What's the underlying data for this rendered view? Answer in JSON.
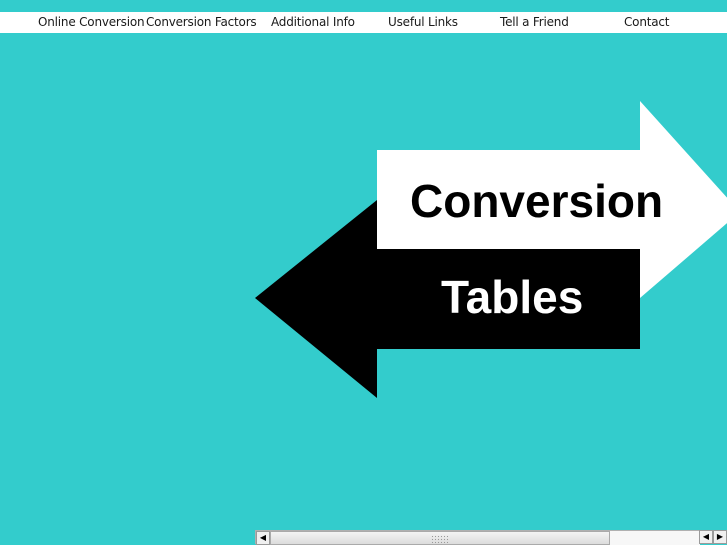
{
  "nav": {
    "items": [
      {
        "label": "Online Conversion"
      },
      {
        "label": "Conversion Factors"
      },
      {
        "label": "Additional Info"
      },
      {
        "label": "Useful Links"
      },
      {
        "label": "Tell a Friend"
      },
      {
        "label": "Contact"
      }
    ]
  },
  "banner": {
    "line1": "Conversion",
    "line2": "Tables"
  },
  "colors": {
    "background": "#33cccc",
    "nav_bg": "#ffffff",
    "arrow_right": "#ffffff",
    "arrow_left": "#000000"
  },
  "scrollbar": {
    "left_arrow_icon": "◀",
    "right_arrow_icon": "▶"
  }
}
